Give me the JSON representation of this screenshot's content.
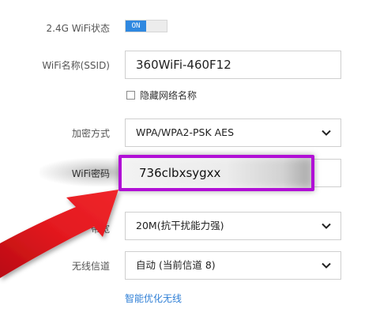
{
  "wifi_status": {
    "label": "2.4G WiFi状态",
    "toggle_text": "ON"
  },
  "ssid": {
    "label": "WiFi名称(SSID)",
    "value": "360WiFi-460F12"
  },
  "hide_network": {
    "label": "隐藏网络名称",
    "checked": false
  },
  "encryption": {
    "label": "加密方式",
    "value": "WPA/WPA2-PSK AES"
  },
  "password": {
    "label": "WiFi密码",
    "value": "736clbxsygxx"
  },
  "bandwidth": {
    "label": "带宽",
    "value": "20M(抗干扰能力强)"
  },
  "channel": {
    "label": "无线信道",
    "value": "自动 (当前信道 8)"
  },
  "optimize_link": "智能优化无线",
  "colors": {
    "toggle_on": "#2f88e0",
    "highlight_border": "#b10fd6",
    "arrow": "#e0181e",
    "link": "#2f7fd6"
  },
  "icons": {
    "select_arrow": "chevron-down-icon",
    "annotation": "red-arrow"
  }
}
